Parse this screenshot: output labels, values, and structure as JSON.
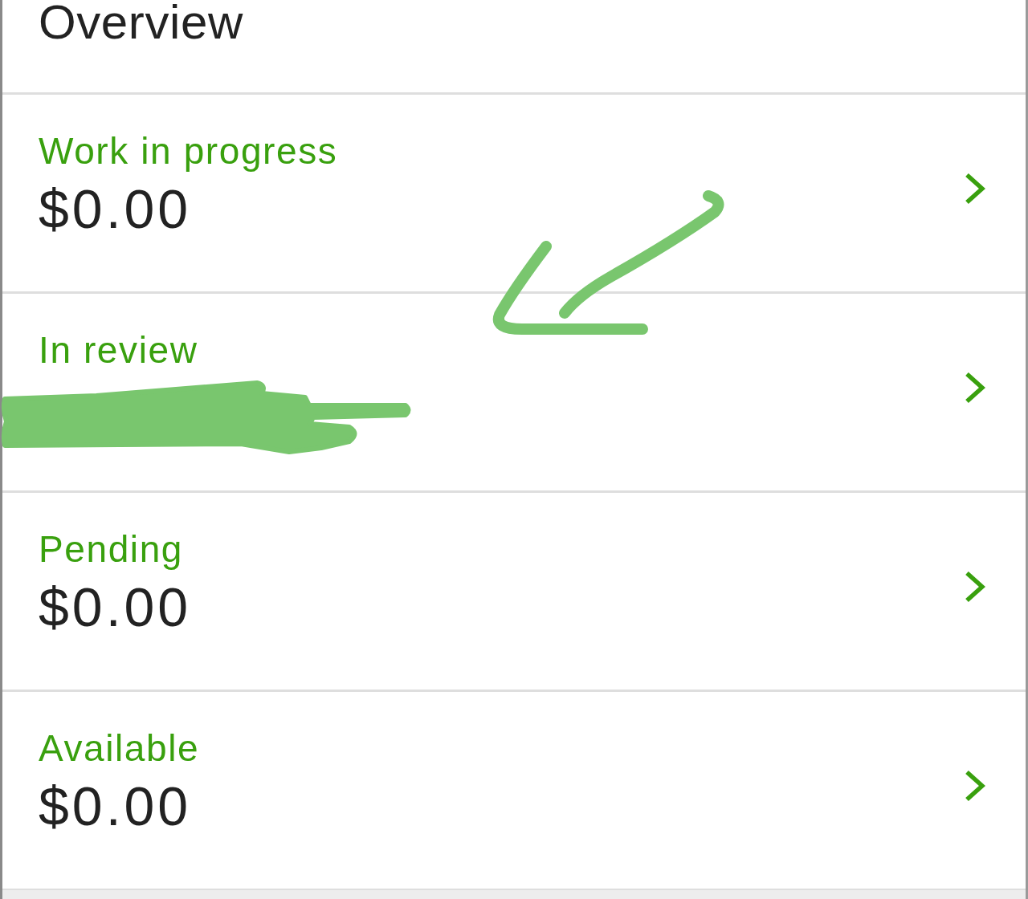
{
  "header": {
    "title": "Overview"
  },
  "rows": [
    {
      "label": "Work in progress",
      "amount": "$0.00"
    },
    {
      "label": "In review"
    },
    {
      "label": "Pending",
      "amount": "$0.00"
    },
    {
      "label": "Available",
      "amount": "$0.00"
    }
  ]
}
